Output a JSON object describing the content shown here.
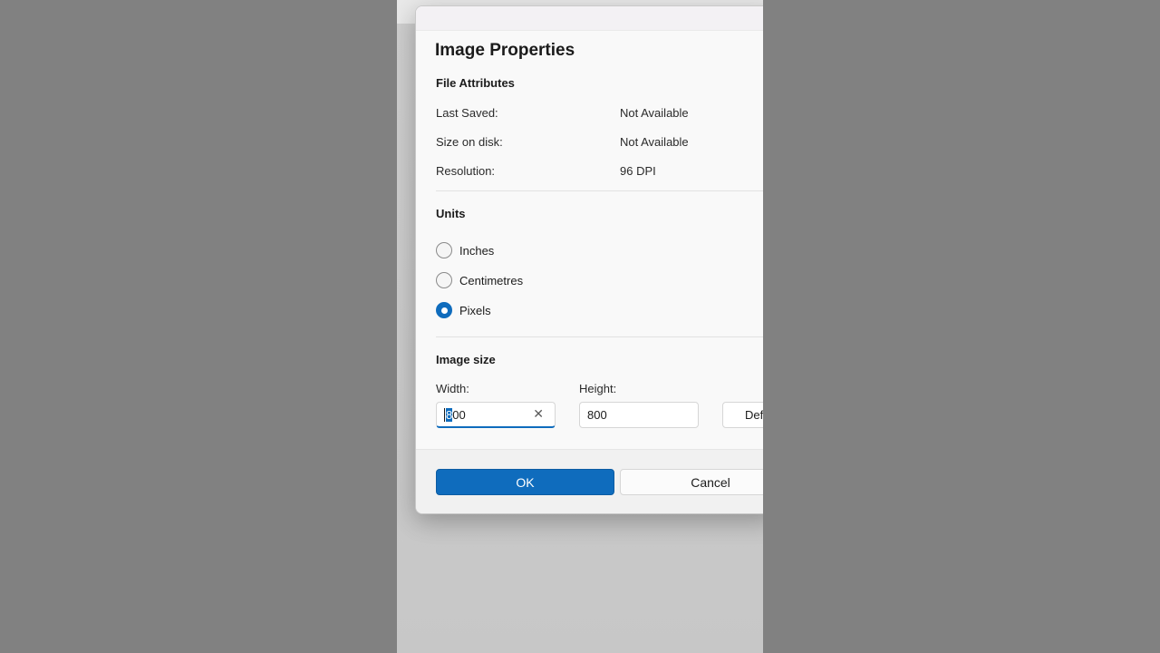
{
  "dialog": {
    "title": "Image Properties"
  },
  "file_attributes": {
    "heading": "File Attributes",
    "rows": [
      {
        "label": "Last Saved:",
        "value": "Not Available"
      },
      {
        "label": "Size on disk:",
        "value": "Not Available"
      },
      {
        "label": "Resolution:",
        "value": "96 DPI"
      }
    ]
  },
  "units": {
    "heading": "Units",
    "options": [
      {
        "label": "Inches",
        "checked": false
      },
      {
        "label": "Centimetres",
        "checked": false
      },
      {
        "label": "Pixels",
        "checked": true
      }
    ]
  },
  "image_size": {
    "heading": "Image size",
    "width_label": "Width:",
    "width_value_selected": "8",
    "width_value_rest": "00",
    "height_label": "Height:",
    "height_value": "800",
    "default_label": "Default"
  },
  "icons": {
    "clear": "✕"
  },
  "buttons": {
    "ok": "OK",
    "cancel": "Cancel"
  },
  "colors": {
    "accent": "#0f6cbd"
  }
}
